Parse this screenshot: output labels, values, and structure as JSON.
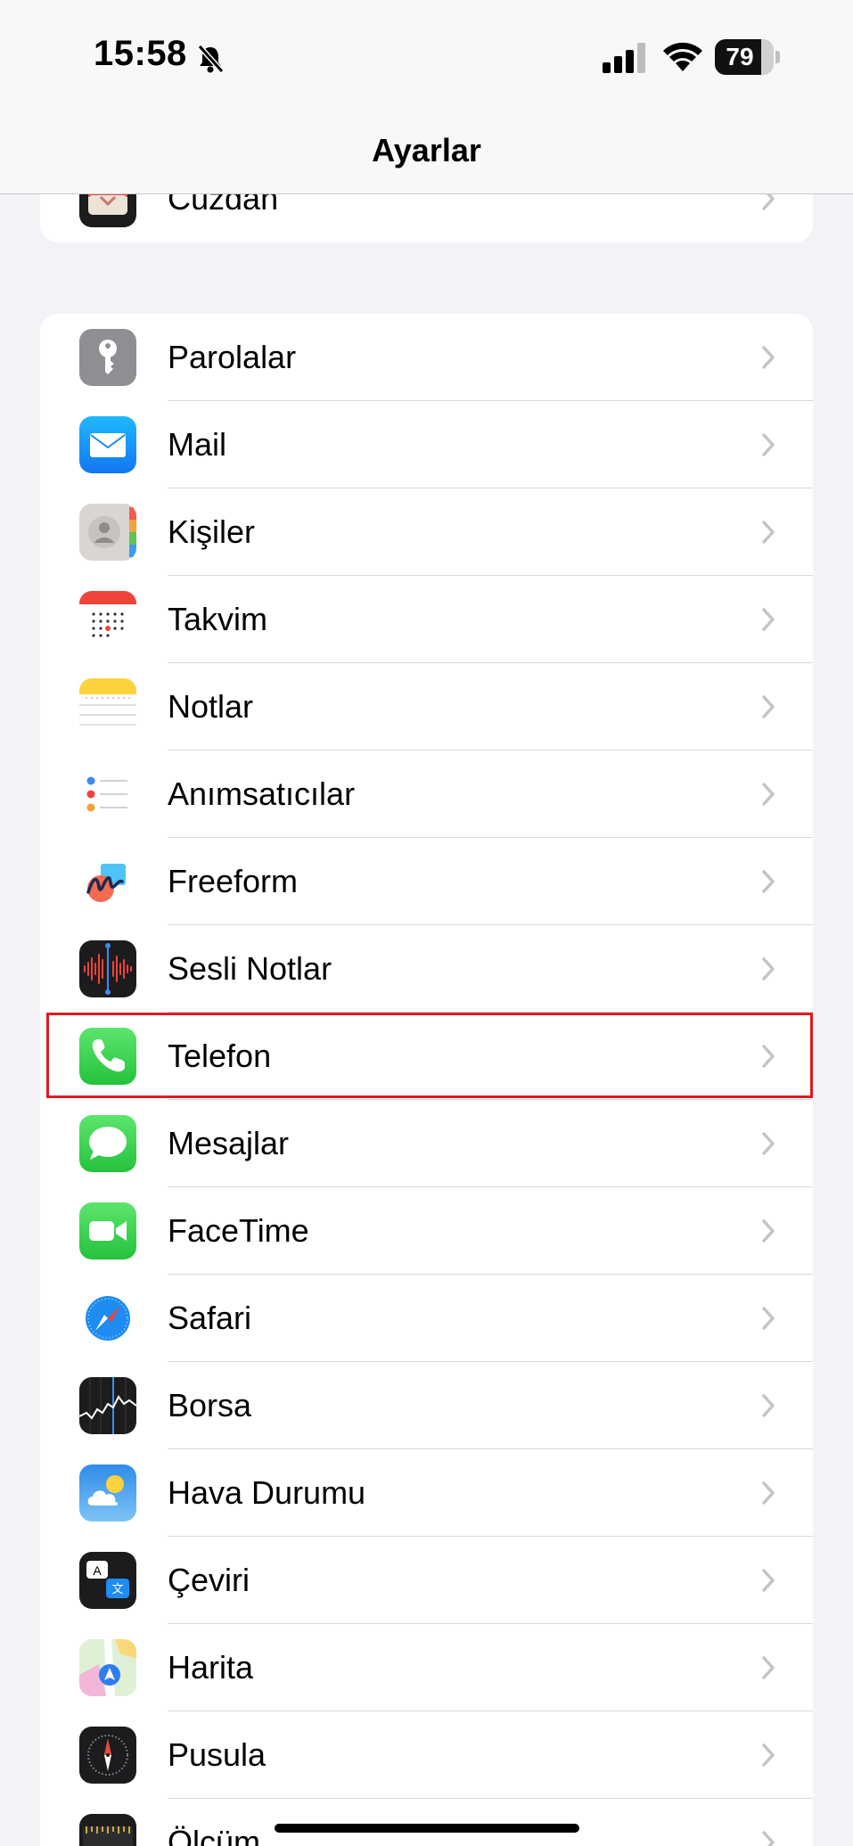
{
  "status": {
    "time": "15:58",
    "battery": "79",
    "battery_level": 0.79
  },
  "nav": {
    "title": "Ayarlar"
  },
  "top_group": [
    {
      "label": "Cüzdan",
      "icon": "wallet-icon"
    }
  ],
  "apps": [
    {
      "label": "Parolalar",
      "icon": "key-icon"
    },
    {
      "label": "Mail",
      "icon": "mail-icon"
    },
    {
      "label": "Kişiler",
      "icon": "contacts-icon"
    },
    {
      "label": "Takvim",
      "icon": "calendar-icon"
    },
    {
      "label": "Notlar",
      "icon": "notes-icon"
    },
    {
      "label": "Anımsatıcılar",
      "icon": "reminders-icon"
    },
    {
      "label": "Freeform",
      "icon": "freeform-icon"
    },
    {
      "label": "Sesli Notlar",
      "icon": "voice-memos-icon"
    },
    {
      "label": "Telefon",
      "icon": "phone-icon"
    },
    {
      "label": "Mesajlar",
      "icon": "messages-icon"
    },
    {
      "label": "FaceTime",
      "icon": "facetime-icon"
    },
    {
      "label": "Safari",
      "icon": "safari-icon"
    },
    {
      "label": "Borsa",
      "icon": "stocks-icon"
    },
    {
      "label": "Hava Durumu",
      "icon": "weather-icon"
    },
    {
      "label": "Çeviri",
      "icon": "translate-icon"
    },
    {
      "label": "Harita",
      "icon": "maps-icon"
    },
    {
      "label": "Pusula",
      "icon": "compass-icon"
    },
    {
      "label": "Ölçüm",
      "icon": "measure-icon"
    }
  ],
  "highlighted_item": "Telefon",
  "colors": {
    "background": "#f2f2f7",
    "highlight_border": "#e01b24",
    "chevron": "#c4c4c7"
  }
}
